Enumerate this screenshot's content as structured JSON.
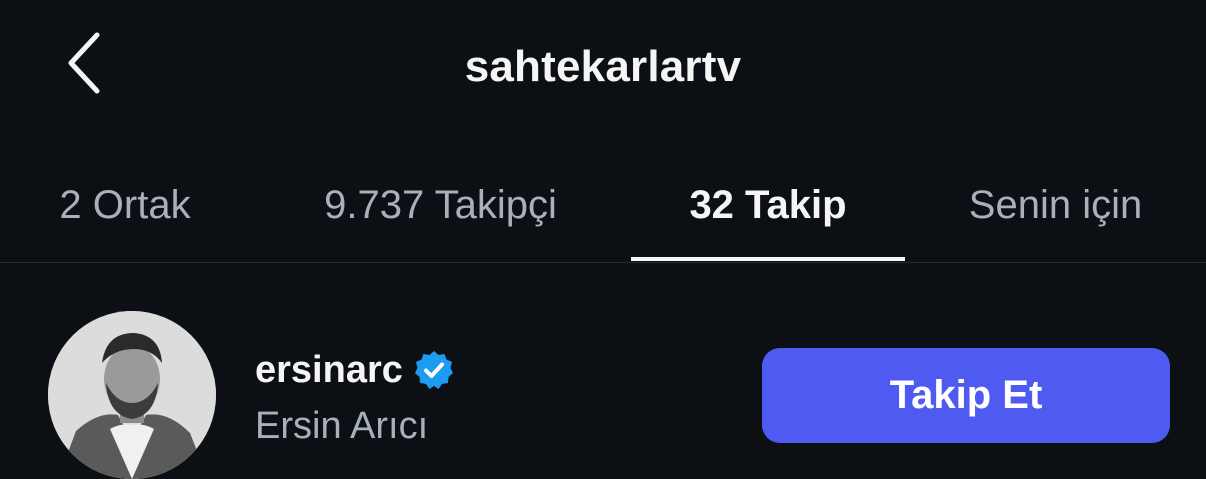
{
  "header": {
    "back_icon": "chevron-left-icon",
    "title": "sahtekarlartv"
  },
  "tabs": [
    {
      "label": "2 Ortak",
      "active": false
    },
    {
      "label": "9.737 Takipçi",
      "active": false
    },
    {
      "label": "32 Takip",
      "active": true
    },
    {
      "label": "Senin için",
      "active": false
    }
  ],
  "list": {
    "items": [
      {
        "username": "ersinarc",
        "verified": true,
        "verified_icon": "verified-badge-icon",
        "full_name": "Ersin Arıcı",
        "follow_label": "Takip Et"
      }
    ]
  },
  "colors": {
    "background": "#0c1014",
    "accent": "#4f5bf0",
    "verified": "#1d9bf0",
    "muted_text": "#a8b0ba"
  }
}
